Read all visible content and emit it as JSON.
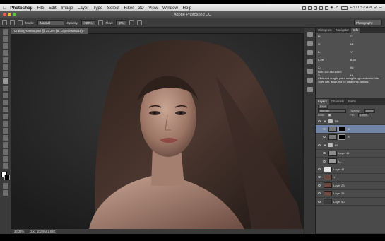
{
  "menubar": {
    "app_name": "Photoshop",
    "items": [
      "File",
      "Edit",
      "Image",
      "Layer",
      "Type",
      "Select",
      "Filter",
      "3D",
      "View",
      "Window",
      "Help"
    ],
    "clock": "Fri 11:52 AM"
  },
  "window": {
    "title": "Adobe Photoshop CC"
  },
  "options": {
    "mode_label": "Mode:",
    "mode_value": "Normal",
    "opacity_label": "Opacity:",
    "opacity_value": "100%",
    "flow_label": "Flow:",
    "flow_value": "2%"
  },
  "workspace": {
    "value": "Photography"
  },
  "document": {
    "tab_title": "Crafting-Demo.psd @ 33.3% (B, Layer Mask/16) *"
  },
  "statusbar": {
    "zoom": "33.33%",
    "doc_size": "Doc: 102.9M/1.86G"
  },
  "info_panel": {
    "tabs": [
      "Histogram",
      "Navigator",
      "Info"
    ],
    "active_tab": "Info",
    "fields": [
      "R:",
      "C:",
      "G:",
      "M:",
      "B:",
      "Y:",
      "8-bit",
      "8-bit",
      "X:",
      "W:",
      "Y:",
      "H:"
    ],
    "doc": "Doc: 102.9M/1.86G",
    "note": "Click and drag to paint using foreground color. Use Shift, Opt, and Cmd for additional options."
  },
  "layers_panel": {
    "tabs": [
      "Layers",
      "Channels",
      "Paths"
    ],
    "active_tab": "Layers",
    "kind_label": "Kind",
    "blend_mode": "Normal",
    "opacity_label": "Opacity:",
    "opacity_value": "100%",
    "lock_label": "Lock:",
    "fill_label": "Fill:",
    "fill_value": "100%",
    "layers": [
      {
        "name": "DB",
        "type": "group"
      },
      {
        "name": "B",
        "type": "masked",
        "selected": true
      },
      {
        "name": "B",
        "type": "masked"
      },
      {
        "name": "FS",
        "type": "group"
      },
      {
        "name": "Layer 44",
        "type": "layer"
      },
      {
        "name": "LL",
        "type": "layer"
      },
      {
        "name": "Layer 41",
        "type": "layer"
      },
      {
        "name": "1",
        "type": "photo"
      },
      {
        "name": "Layer 23",
        "type": "photo"
      },
      {
        "name": "Layer 24",
        "type": "photo"
      },
      {
        "name": "Layer 40",
        "type": "layer"
      }
    ]
  },
  "colors": {
    "selection": "#7185a8",
    "panel": "#464646",
    "canvas_bg": "#262626"
  }
}
